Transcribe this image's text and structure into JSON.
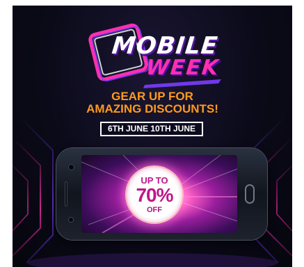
{
  "logo": {
    "line1": "MOBILE",
    "line2": "WEEK"
  },
  "headline": {
    "line1": "GEAR UP FOR",
    "line2": "AMAZING DISCOUNTS!"
  },
  "dates": "6TH JUNE 10TH JUNE",
  "offer": {
    "line1": "UP TO",
    "line2": "70%",
    "line3": "OFF"
  },
  "colors": {
    "background": "#0b0a18",
    "headline": "#ff9a1f",
    "logo_accent": "#ff2fb0",
    "logo_purple": "#5a1e9e",
    "offer_text": "#c0168a",
    "glow_pink": "#ff5fc6"
  },
  "icons": [
    "phone-outline-icon",
    "smartphone-icon"
  ]
}
